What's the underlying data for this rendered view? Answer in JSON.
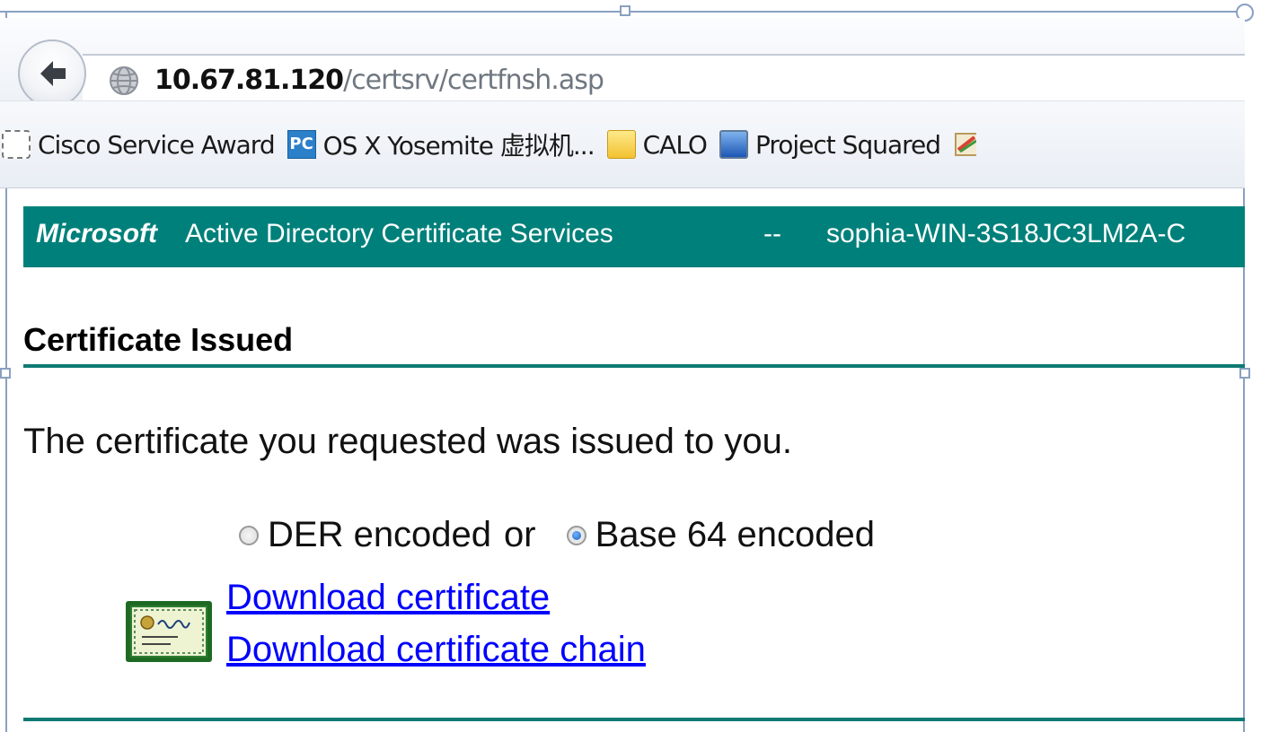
{
  "browser": {
    "url_host": "10.67.81.120",
    "url_path": "/certsrv/certfnsh.asp",
    "icons": {
      "back": "back-arrow-icon",
      "site": "globe-icon"
    }
  },
  "bookmarks": [
    {
      "label": "Cisco Service Award",
      "icon": "dashed-square-icon"
    },
    {
      "label": "OS X Yosemite 虚拟机...",
      "icon": "pc-icon",
      "icon_text": "PC"
    },
    {
      "label": "CALO",
      "icon": "folder-icon"
    },
    {
      "label": "Project Squared",
      "icon": "blue-square-icon"
    }
  ],
  "page": {
    "header_brand": "Microsoft",
    "header_title": "Active Directory Certificate Services",
    "header_separator": "--",
    "header_ca": "sophia-WIN-3S18JC3LM2A-C",
    "title": "Certificate Issued",
    "message": "The certificate you requested was issued to you.",
    "encoding": {
      "der_label": "DER encoded",
      "or_label": "or",
      "base64_label": "Base 64 encoded",
      "selected": "Base 64 encoded"
    },
    "download_certificate": "Download certificate",
    "download_chain": "Download certificate chain"
  },
  "colors": {
    "header_band": "#00807a",
    "rule": "#0f7a74",
    "link": "#0000ff"
  }
}
